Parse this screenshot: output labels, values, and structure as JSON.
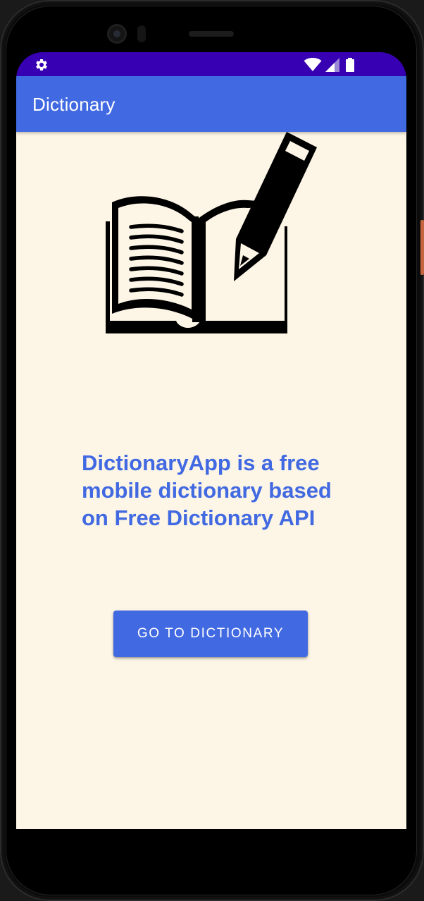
{
  "status_bar": {
    "left_icon": "settings-gear-icon",
    "right_icons": [
      "wifi-icon",
      "cellular-signal-icon",
      "battery-icon"
    ],
    "background_color": "#3700b3"
  },
  "app_bar": {
    "title": "Dictionary",
    "background_color": "#4169e1"
  },
  "main": {
    "logo_icon": "open-book-with-pencil-icon",
    "description": "DictionaryApp is a free mobile dictionary based on Free Dictionary API",
    "button_label": "GO TO DICTIONARY",
    "text_color": "#4169e1",
    "background_color": "#fdf5e6"
  }
}
